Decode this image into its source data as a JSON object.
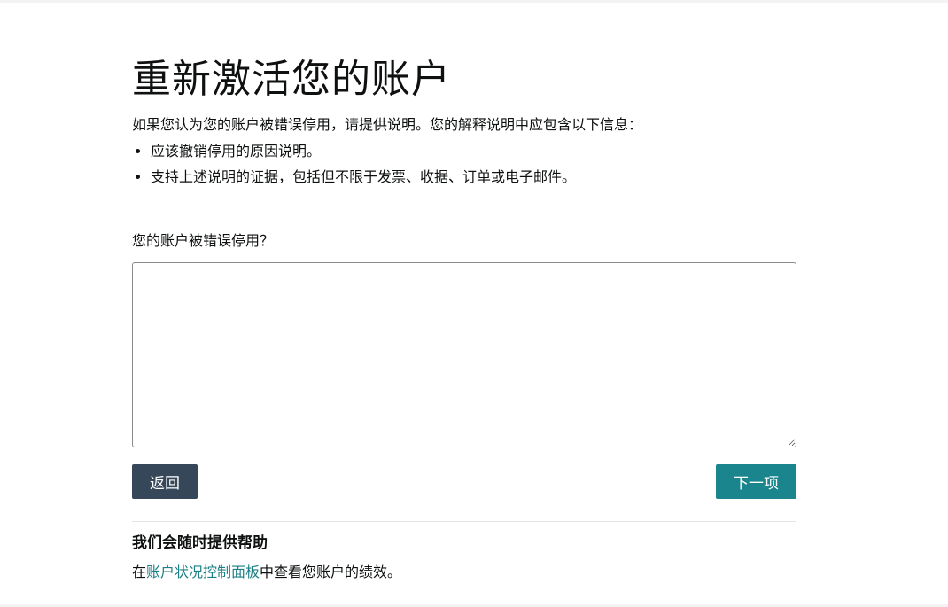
{
  "page": {
    "title": "重新激活您的账户",
    "intro": "如果您认为您的账户被错误停用，请提供说明。您的解释说明中应包含以下信息：",
    "reasons": [
      "应该撤销停用的原因说明。",
      "支持上述说明的证据，包括但不限于发票、收据、订单或电子邮件。"
    ]
  },
  "form": {
    "question_label": "您的账户被错误停用？",
    "explanation_value": "",
    "back_label": "返回",
    "next_label": "下一项"
  },
  "help": {
    "title": "我们会随时提供帮助",
    "text_prefix": "在",
    "link_label": "账户状况控制面板",
    "text_suffix": "中查看您账户的绩效。"
  },
  "colors": {
    "back_button": "#37475a",
    "next_button": "#1a858c",
    "link": "#1a7f86"
  }
}
